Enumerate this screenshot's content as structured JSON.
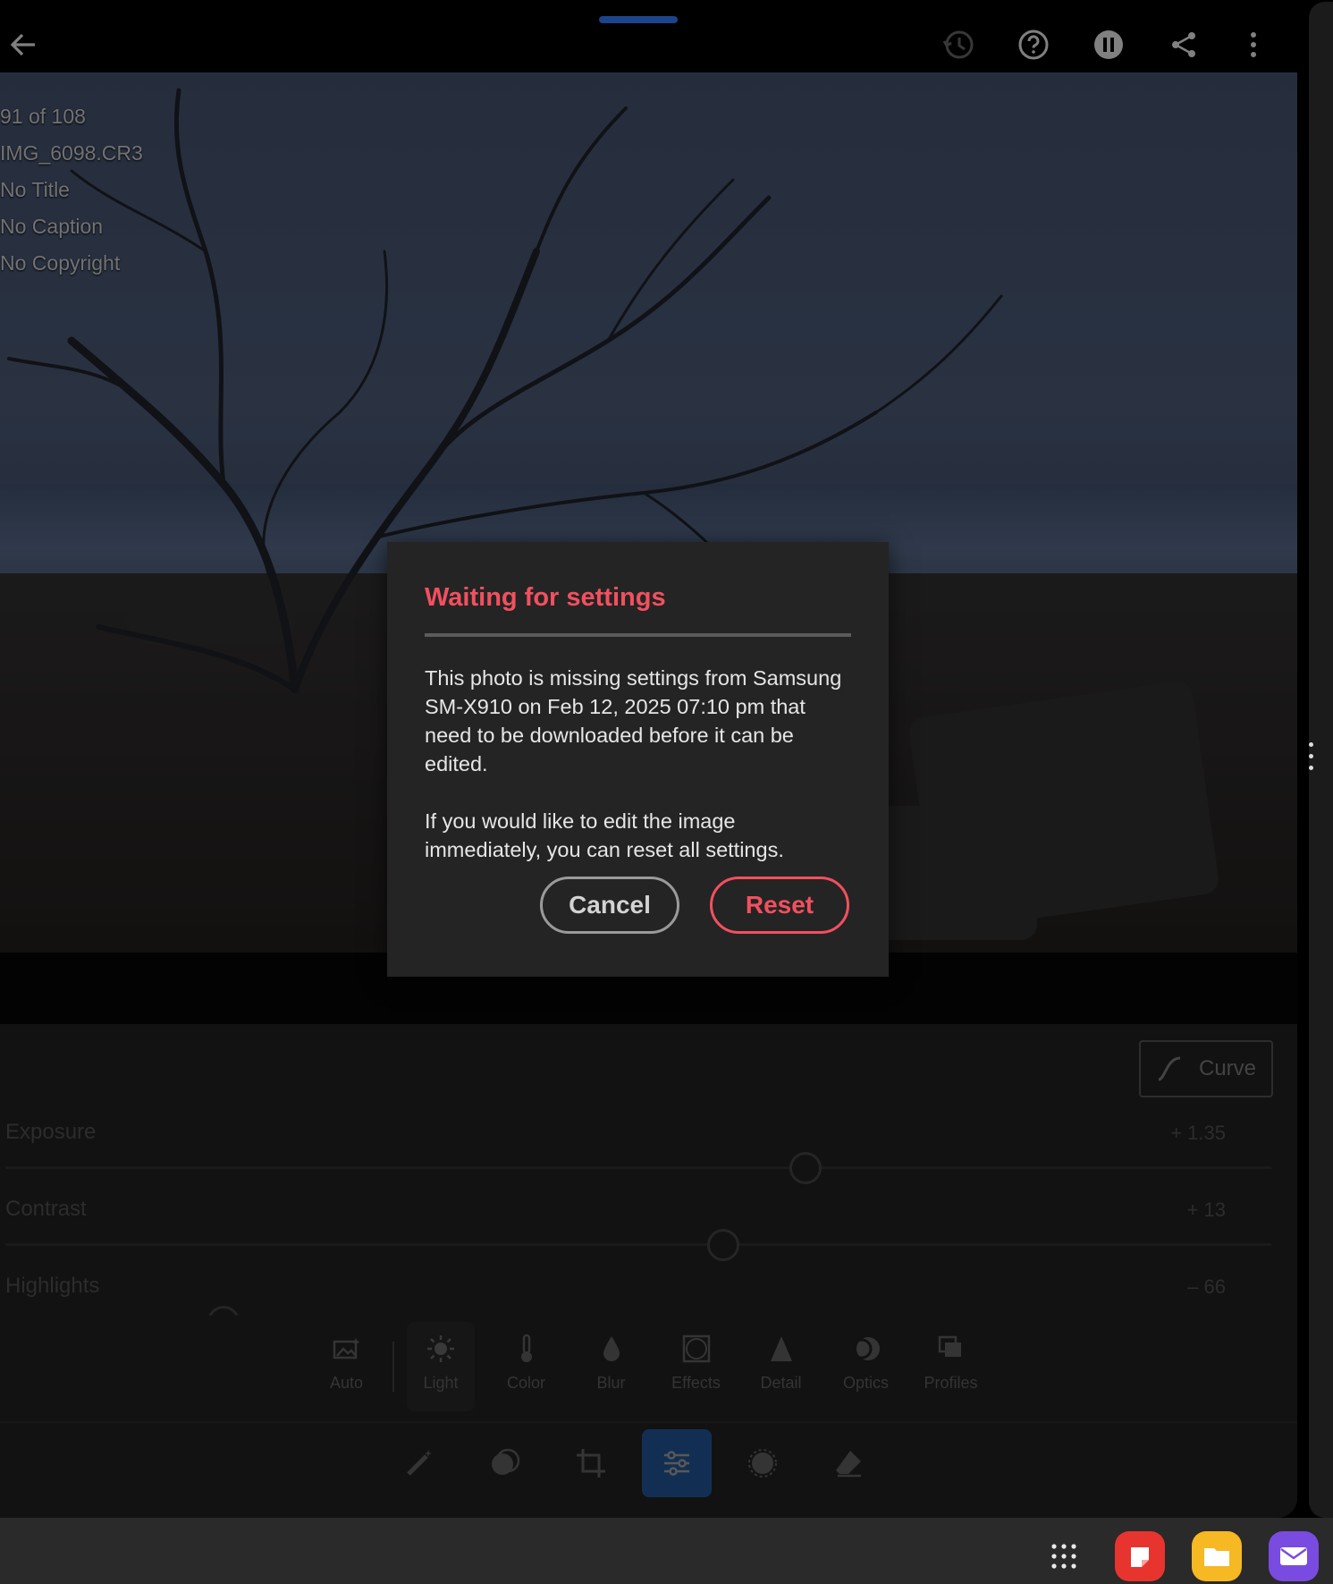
{
  "topbar": {
    "icons": [
      "back-arrow-icon",
      "history-icon",
      "help-icon",
      "pause-icon",
      "share-icon",
      "more-vertical-icon"
    ]
  },
  "photo_info": {
    "position": "91 of 108",
    "filename": "IMG_6098.CR3",
    "title": "No Title",
    "caption": "No Caption",
    "copyright": "No Copyright"
  },
  "dialog": {
    "title": "Waiting for settings",
    "body1": "This photo is missing settings from Samsung SM-X910 on Feb 12, 2025 07:10 pm that need to be downloaded before it can be edited.",
    "body2": "If you would like to edit the image immediately, you can reset all settings.",
    "cancel_label": "Cancel",
    "reset_label": "Reset",
    "title_color": "#f2505f"
  },
  "panel": {
    "curve_label": "Curve",
    "sliders": [
      {
        "label": "Exposure",
        "value": "+ 1.35",
        "position": 0.63
      },
      {
        "label": "Contrast",
        "value": "+ 13",
        "position": 0.565
      },
      {
        "label": "Highlights",
        "value": "– 66",
        "position": 0.17
      }
    ]
  },
  "tabs": [
    {
      "label": "Auto",
      "icon": "auto-icon"
    },
    {
      "label": "Light",
      "icon": "sun-icon"
    },
    {
      "label": "Color",
      "icon": "thermometer-icon"
    },
    {
      "label": "Blur",
      "icon": "droplet-icon"
    },
    {
      "label": "Effects",
      "icon": "vignette-icon"
    },
    {
      "label": "Detail",
      "icon": "triangle-icon"
    },
    {
      "label": "Optics",
      "icon": "lens-icon"
    },
    {
      "label": "Profiles",
      "icon": "stack-icon"
    }
  ],
  "tools": [
    "healing-brush-icon",
    "masking-icon",
    "crop-icon",
    "adjust-sliders-icon",
    "presets-icon",
    "eraser-icon"
  ],
  "accent_color": "#1d4c87",
  "dock": [
    "app-drawer-icon",
    "notes-app-icon",
    "files-app-icon",
    "mail-app-icon"
  ]
}
